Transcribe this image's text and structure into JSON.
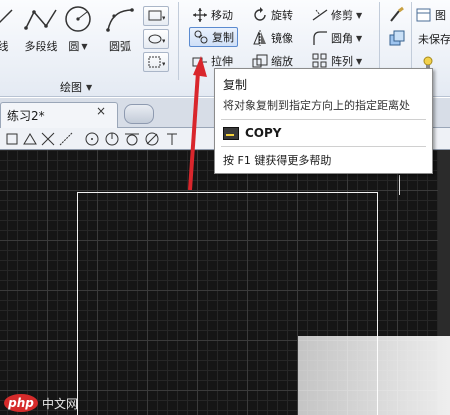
{
  "ribbon": {
    "draw_tools": [
      {
        "label": "线",
        "icon": "line-icon"
      },
      {
        "label": "多段线",
        "icon": "polyline-icon"
      },
      {
        "label": "圆",
        "icon": "circle-icon"
      },
      {
        "label": "圆弧",
        "icon": "arc-icon"
      }
    ],
    "draw_panel_title": "绘图",
    "modify_tools": {
      "move": "移动",
      "rotate": "旋转",
      "trim": "修剪",
      "copy": "复制",
      "mirror": "镜像",
      "fillet": "圆角",
      "stretch": "拉伸",
      "scale": "缩放",
      "array": "阵列"
    },
    "right_label_1": "图",
    "right_label_2": "未保存"
  },
  "tabs": {
    "active_tab": "练习2*",
    "close_symbol": "×"
  },
  "tooltip": {
    "title": "复制",
    "description": "将对象复制到指定方向上的指定距离处",
    "command": "COPY",
    "help": "按 F1 键获得更多帮助"
  },
  "watermark": {
    "logo": "php",
    "text": "中文网"
  },
  "colors": {
    "canvas_bg": "#151515",
    "arrow": "#d9262c",
    "ribbon_bg": "#e4eaf3"
  }
}
